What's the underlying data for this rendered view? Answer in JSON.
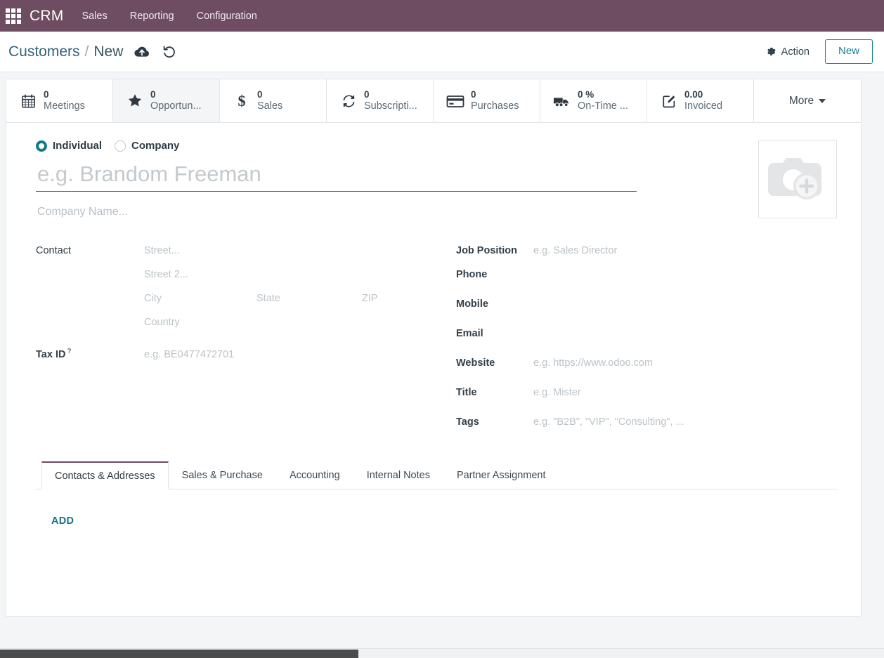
{
  "navbar": {
    "apps_icon": "apps-grid-icon",
    "brand": "CRM",
    "menu": [
      {
        "label": "Sales"
      },
      {
        "label": "Reporting"
      },
      {
        "label": "Configuration"
      }
    ]
  },
  "control_panel": {
    "breadcrumb": {
      "root": "Customers",
      "separator": "/",
      "current": "New"
    },
    "save_icon": "cloud-upload-icon",
    "discard_icon": "undo-icon",
    "action_label": "Action",
    "action_icon": "gear-icon",
    "new_label": "New"
  },
  "button_box": {
    "buttons": [
      {
        "value": "0",
        "label": "Meetings",
        "icon": "calendar-icon",
        "active": false
      },
      {
        "value": "0",
        "label": "Opportun...",
        "icon": "star-icon",
        "active": true
      },
      {
        "value": "0",
        "label": "Sales",
        "icon": "dollar-icon",
        "active": false
      },
      {
        "value": "0",
        "label": "Subscripti...",
        "icon": "refresh-icon",
        "active": false
      },
      {
        "value": "0",
        "label": "Purchases",
        "icon": "credit-card-icon",
        "active": false
      },
      {
        "value": "0 %",
        "label": "On-Time ...",
        "icon": "truck-icon",
        "active": false
      },
      {
        "value": "0.00",
        "label": "Invoiced",
        "icon": "pencil-square-icon",
        "active": false
      }
    ],
    "more_label": "More"
  },
  "form": {
    "company_type": {
      "selected": "individual",
      "individual_label": "Individual",
      "company_label": "Company"
    },
    "name_placeholder": "e.g. Brandom Freeman",
    "name_value": "",
    "company_name_placeholder": "Company Name...",
    "company_name_value": "",
    "avatar_icon": "camera-add-icon",
    "left": {
      "contact_label": "Contact",
      "street_placeholder": "Street...",
      "street2_placeholder": "Street 2...",
      "city_placeholder": "City",
      "state_placeholder": "State",
      "zip_placeholder": "ZIP",
      "country_placeholder": "Country",
      "tax_id_label": "Tax ID",
      "tax_id_help": "?",
      "tax_id_placeholder": "e.g. BE0477472701"
    },
    "right": {
      "job_position_label": "Job Position",
      "job_position_placeholder": "e.g. Sales Director",
      "phone_label": "Phone",
      "phone_placeholder": "",
      "mobile_label": "Mobile",
      "mobile_placeholder": "",
      "email_label": "Email",
      "email_placeholder": "",
      "website_label": "Website",
      "website_placeholder": "e.g. https://www.odoo.com",
      "title_label": "Title",
      "title_placeholder": "e.g. Mister",
      "tags_label": "Tags",
      "tags_placeholder": "e.g. \"B2B\", \"VIP\", \"Consulting\", ..."
    }
  },
  "notebook": {
    "tabs": [
      {
        "label": "Contacts & Addresses",
        "active": true
      },
      {
        "label": "Sales & Purchase",
        "active": false
      },
      {
        "label": "Accounting",
        "active": false
      },
      {
        "label": "Internal Notes",
        "active": false
      },
      {
        "label": "Partner Assignment",
        "active": false
      }
    ],
    "add_label": "ADD"
  },
  "colors": {
    "navbar_purple": "#6e4c61",
    "accent_teal": "#0e7c8c",
    "tab_accent": "#714b67",
    "link_blue": "#17728a"
  }
}
